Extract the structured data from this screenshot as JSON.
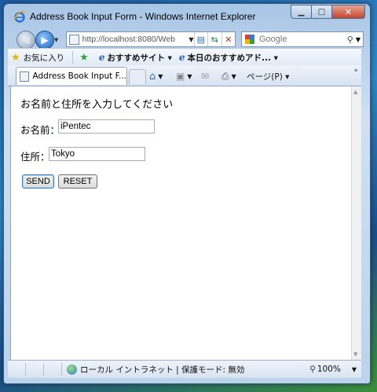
{
  "window": {
    "title": "Address Book Input Form - Windows Internet Explorer"
  },
  "address_bar": {
    "url": "http://localhost:8080/Web"
  },
  "search_box": {
    "placeholder": "Google"
  },
  "favorites_bar": {
    "favorites_label": "お気に入り",
    "items": [
      "おすすめサイト ▾",
      "本日のおすすめアド... ▾"
    ]
  },
  "tabs": [
    {
      "label": "Address Book Input F..."
    }
  ],
  "command_bar": {
    "page_label": "ページ(P) ▾"
  },
  "page": {
    "heading": "お名前と住所を入力してください",
    "name_label": "お名前：",
    "name_value": "iPentec",
    "address_label": "住所：",
    "address_value": "Tokyo",
    "send_label": "SEND",
    "reset_label": "RESET"
  },
  "status_bar": {
    "zone_text": "ローカル イントラネット | 保護モード: 無効",
    "zoom": "100%"
  },
  "icons": [
    "ie-icon",
    "back-icon",
    "forward-icon",
    "page-icon",
    "compatibility-icon",
    "refresh-icon",
    "stop-icon",
    "google-icon",
    "search-icon",
    "star-icon",
    "add-favorite-icon",
    "home-icon",
    "rss-icon",
    "mail-icon",
    "print-icon",
    "globe-icon",
    "zoom-icon"
  ],
  "colors": {
    "title_bar": "#bcd3ec",
    "send_button_border": "#3c7fb1"
  }
}
